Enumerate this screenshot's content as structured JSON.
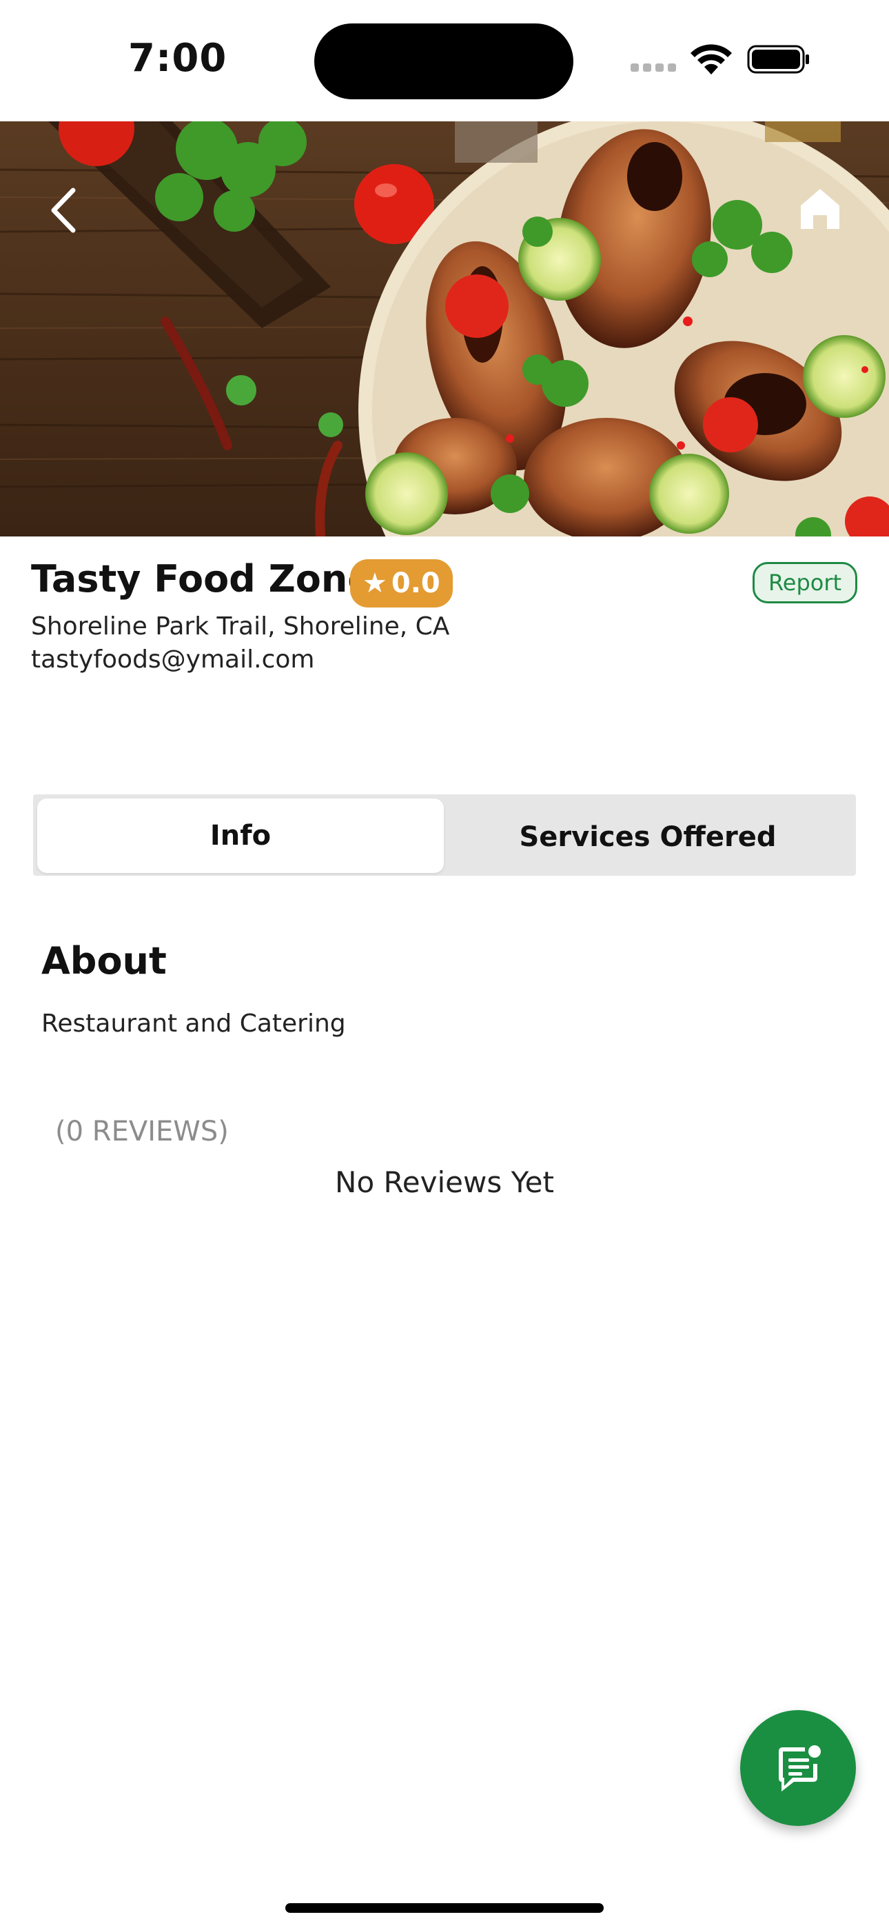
{
  "status_bar": {
    "time": "7:00"
  },
  "hero": {
    "back_icon": "chevron-left-icon",
    "home_icon": "home-icon"
  },
  "business": {
    "name": "Tasty Food Zone",
    "rating": "0.0",
    "report_label": "Report",
    "address": "Shoreline Park Trail, Shoreline, CA",
    "email": "tastyfoods@ymail.com"
  },
  "tabs": [
    {
      "label": "Info",
      "active": true
    },
    {
      "label": "Services Offered",
      "active": false
    }
  ],
  "about": {
    "title": "About",
    "text": "Restaurant and Catering"
  },
  "reviews": {
    "count_label": "(0 REVIEWS)",
    "empty_label": "No Reviews Yet"
  },
  "fab": {
    "icon": "chat-icon"
  },
  "colors": {
    "accent": "#1a8f42",
    "rating_badge": "#e39b32",
    "tab_bg": "#e6e6e6"
  }
}
